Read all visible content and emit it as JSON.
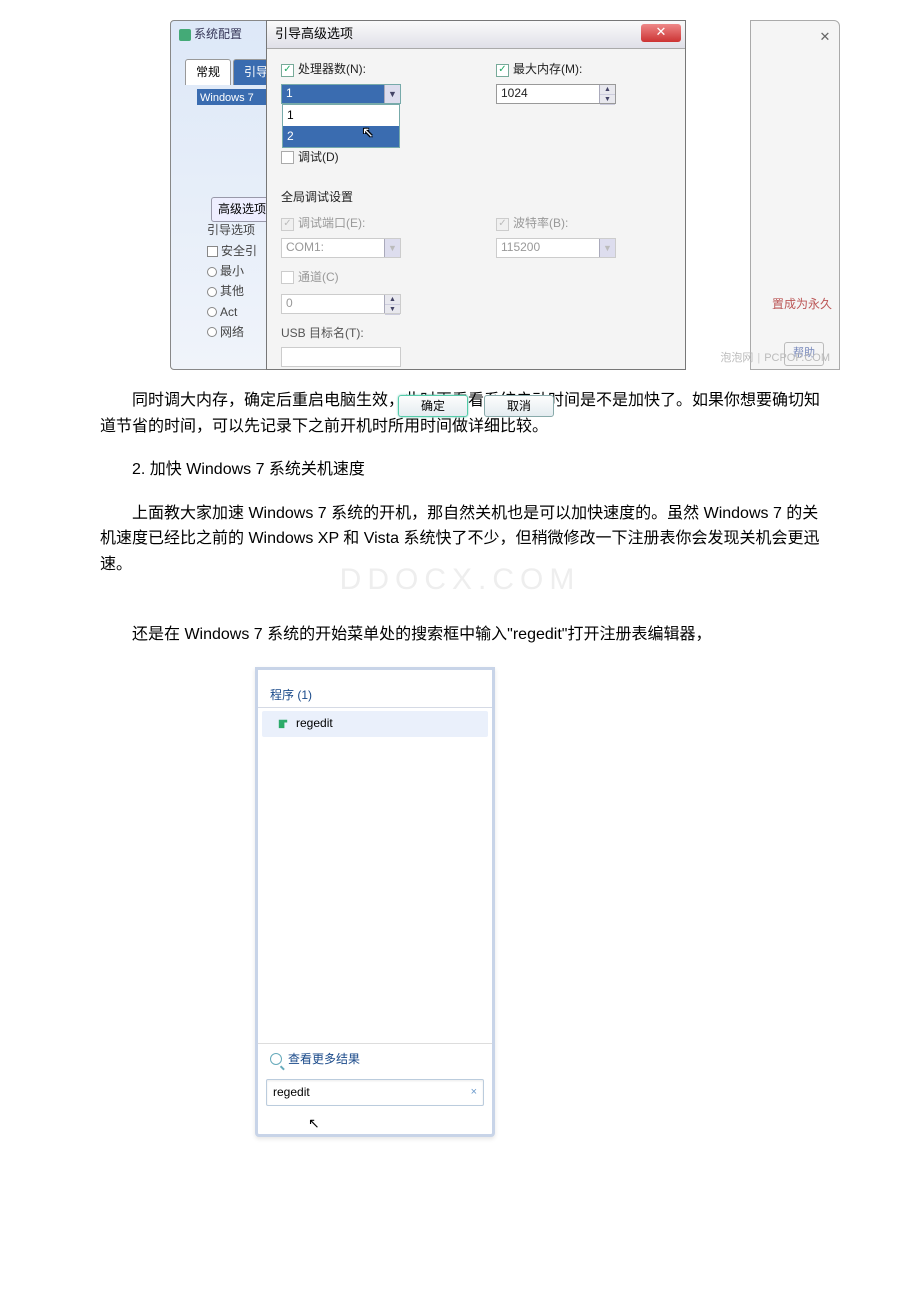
{
  "bgDialog": {
    "title": "系统配置",
    "tabs": [
      "常规",
      "引导"
    ],
    "listSel": "Windows 7",
    "advBtn": "高级选项",
    "bootGroup": "引导选项",
    "safe": "安全引",
    "rMin": "最小",
    "rOther": "其他",
    "rAct": "Act",
    "rNet": "网络",
    "sideText": "置成为永久",
    "helpBtn": "帮助",
    "closeSym": "✕"
  },
  "dlg": {
    "title": "引导高级选项",
    "closeSym": "✕",
    "cpuLabel": "处理器数(N):",
    "cpuValue": "1",
    "cpuOpts": [
      "1",
      "2"
    ],
    "memLabel": "最大内存(M):",
    "memValue": "1024",
    "debugChk": "调试(D)",
    "globalTitle": "全局调试设置",
    "portLabel": "调试端口(E):",
    "portValue": "COM1:",
    "baudLabel": "波特率(B):",
    "baudValue": "115200",
    "chanLabel": "通道(C)",
    "chanValue": "0",
    "usbLabel": "USB 目标名(T):",
    "ok": "确定",
    "cancel": "取消"
  },
  "watermark": {
    "left": "泡泡网",
    "right": "PCPOP.COM"
  },
  "para1": "同时调大内存，确定后重启电脑生效，此时再看看系统启动时间是不是加快了。如果你想要确切知道节省的时间，可以先记录下之前开机时所用时间做详细比较。",
  "para2": "2. 加快 Windows 7 系统关机速度",
  "para3": "上面教大家加速 Windows 7 系统的开机，那自然关机也是可以加快速度的。虽然 Windows 7 的关机速度已经比之前的 Windows XP 和 Vista 系统快了不少，但稍微修改一下注册表你会发现关机会更迅速。",
  "para4pre": "还是在 Windows 7 系统的开始菜单处的搜索框中输入",
  "para4q": "\"regedit\"",
  "para4post": "打开注册表编辑器，",
  "docWatermark": "DDOCX.COM",
  "startMenu": {
    "header": "程序 (1)",
    "item": "regedit",
    "more": "查看更多结果",
    "search": "regedit",
    "xSym": "×"
  }
}
